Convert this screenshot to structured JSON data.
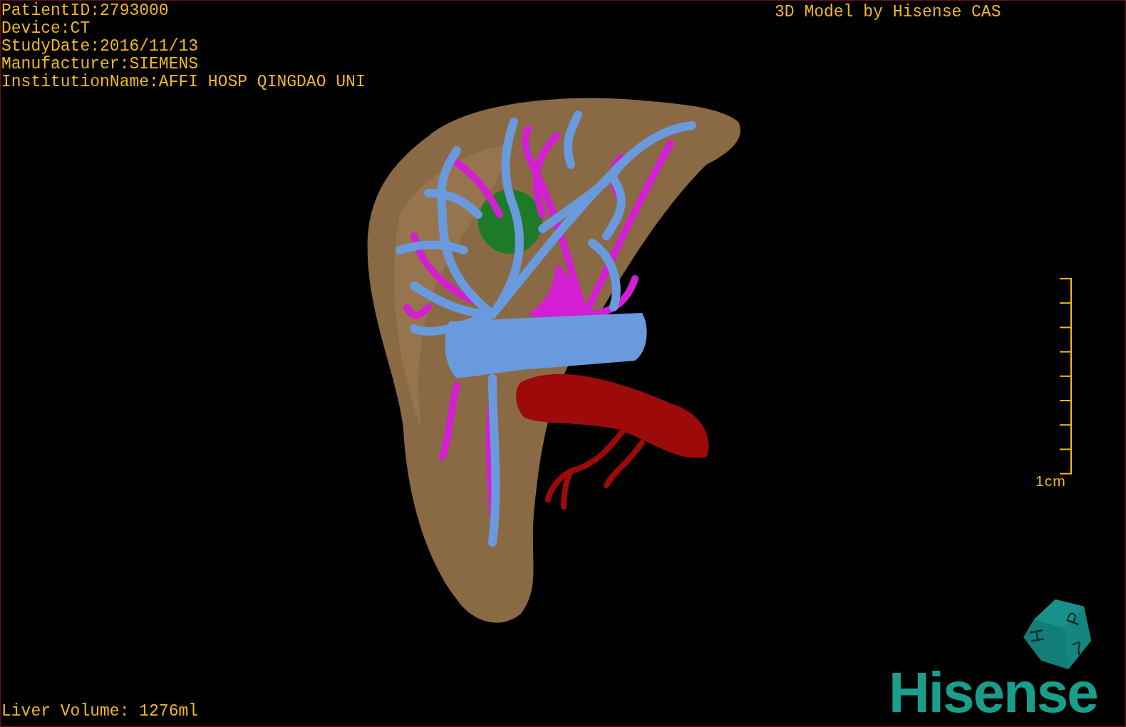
{
  "patient_info": [
    "PatientID:2793000",
    "Device:CT",
    "StudyDate:2016/11/13",
    "Manufacturer:SIEMENS",
    "InstitutionName:AFFI HOSP QINGDAO UNI"
  ],
  "title": "3D Model by Hisense CAS",
  "scale_bar": {
    "label": "1cm"
  },
  "orientation_cube": {
    "faces": [
      "P",
      "H",
      "7"
    ]
  },
  "logo": "Hisense",
  "liver_volume": "Liver Volume: 1276ml"
}
